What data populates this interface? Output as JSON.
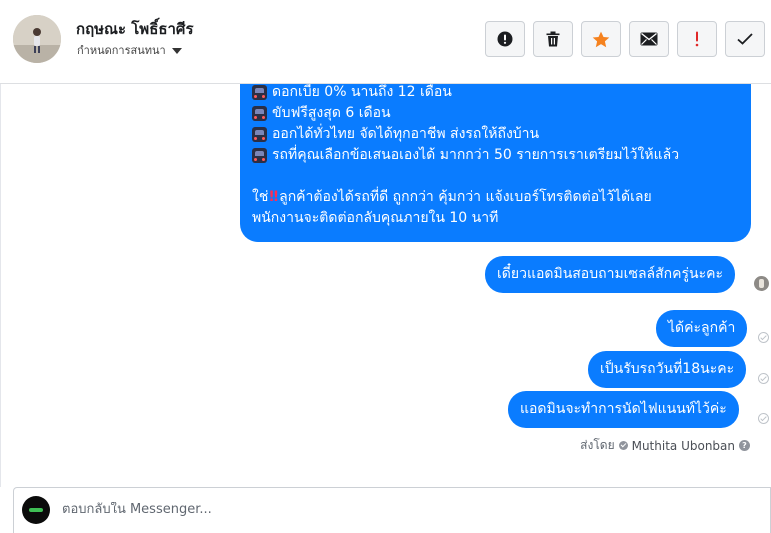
{
  "header": {
    "contact_name": "กฤษณะ โพธิ์ธาศีร",
    "assign_label": "กำหนดการสนทนา",
    "actions": [
      {
        "name": "mark-spam-button",
        "icon": "alert-circle-icon"
      },
      {
        "name": "delete-button",
        "icon": "trash-icon"
      },
      {
        "name": "star-button",
        "icon": "star-icon"
      },
      {
        "name": "mark-unread-button",
        "icon": "envelope-icon"
      },
      {
        "name": "follow-up-button",
        "icon": "exclamation-icon"
      },
      {
        "name": "mark-done-button",
        "icon": "checkmark-icon"
      }
    ]
  },
  "thread": {
    "big_bubble": {
      "lines": [
        "ดอกเบี้ย 0% นานถึง 12 เดือน",
        "ขับฟรีสูงสุด 6 เดือน",
        "ออกได้ทั่วไทย จัดได้ทุกอาชีพ ส่งรถให้ถึงบ้าน",
        "รถที่คุณเลือกข้อเสนอเองได้ มากกว่า 50 รายการเราเตรียมไว้ให้แล้ว"
      ],
      "cta_start": "ใช่",
      "cta_rest": "ลูกค้าต้องได้รถที่ดี ถูกกว่า คุ้มกว่า แจ้งเบอร์โทรติดต่อไว้ได้เลย",
      "cta_line2": "พนักงานจะติดต่อกลับคุณภายใน 10 นาที"
    },
    "messages": [
      "เดี๋ยวแอดมินสอบถามเซลล์สักครู่นะคะ",
      "ได้ค่ะลูกค้า",
      "เป็นรับรถวันที่18นะคะ",
      "แอดมินจะทำการนัดไฟแนนท์ไว้ค่ะ"
    ],
    "sent_by_label": "ส่งโดย",
    "sent_by_agent": "Muthita Ubonban"
  },
  "composer": {
    "placeholder": "ตอบกลับใน Messenger..."
  },
  "colors": {
    "bubble": "#0a7cff",
    "star": "#f5821f",
    "follow_up": "#e02828"
  }
}
